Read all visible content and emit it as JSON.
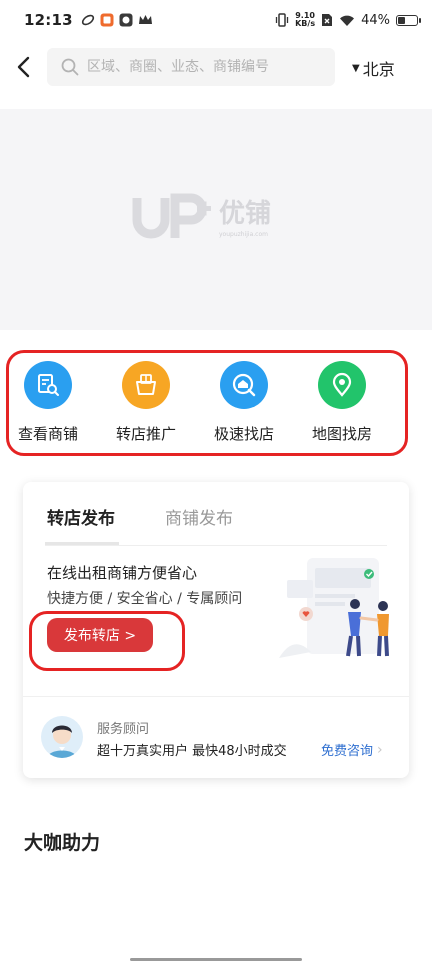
{
  "status_bar": {
    "time": "12:13",
    "net_speed_value": "9.10",
    "net_speed_unit": "KB/s",
    "battery_text": "44%",
    "battery_level": 0.44
  },
  "header": {
    "search_placeholder": "区域、商圈、业态、商铺编号",
    "city": "北京"
  },
  "banner": {
    "logo_text": "优铺",
    "logo_sub": "youpuzhijia.com"
  },
  "quick_nav": [
    {
      "label": "查看商铺",
      "icon": "shop-search-icon",
      "color": "#2a9ff0"
    },
    {
      "label": "转店推广",
      "icon": "transfer-promo-icon",
      "color": "#f7a624"
    },
    {
      "label": "极速找店",
      "icon": "fast-find-icon",
      "color": "#2a9ff0"
    },
    {
      "label": "地图找房",
      "icon": "map-pin-icon",
      "color": "#22c46b"
    }
  ],
  "card": {
    "tabs": [
      {
        "label": "转店发布",
        "active": true
      },
      {
        "label": "商铺发布",
        "active": false
      }
    ],
    "promo_title": "在线出租商铺方便省心",
    "promo_sub": "快捷方便 / 安全省心 / 专属顾问",
    "publish_label": "发布转店 >",
    "advisor_title": "服务顾问",
    "advisor_desc": "超十万真实用户 最快48小时成交",
    "consult_label": "免费咨询"
  },
  "section_title": "大咖助力",
  "colors": {
    "accent_red": "#d9383a",
    "link_blue": "#2f6fd0"
  }
}
